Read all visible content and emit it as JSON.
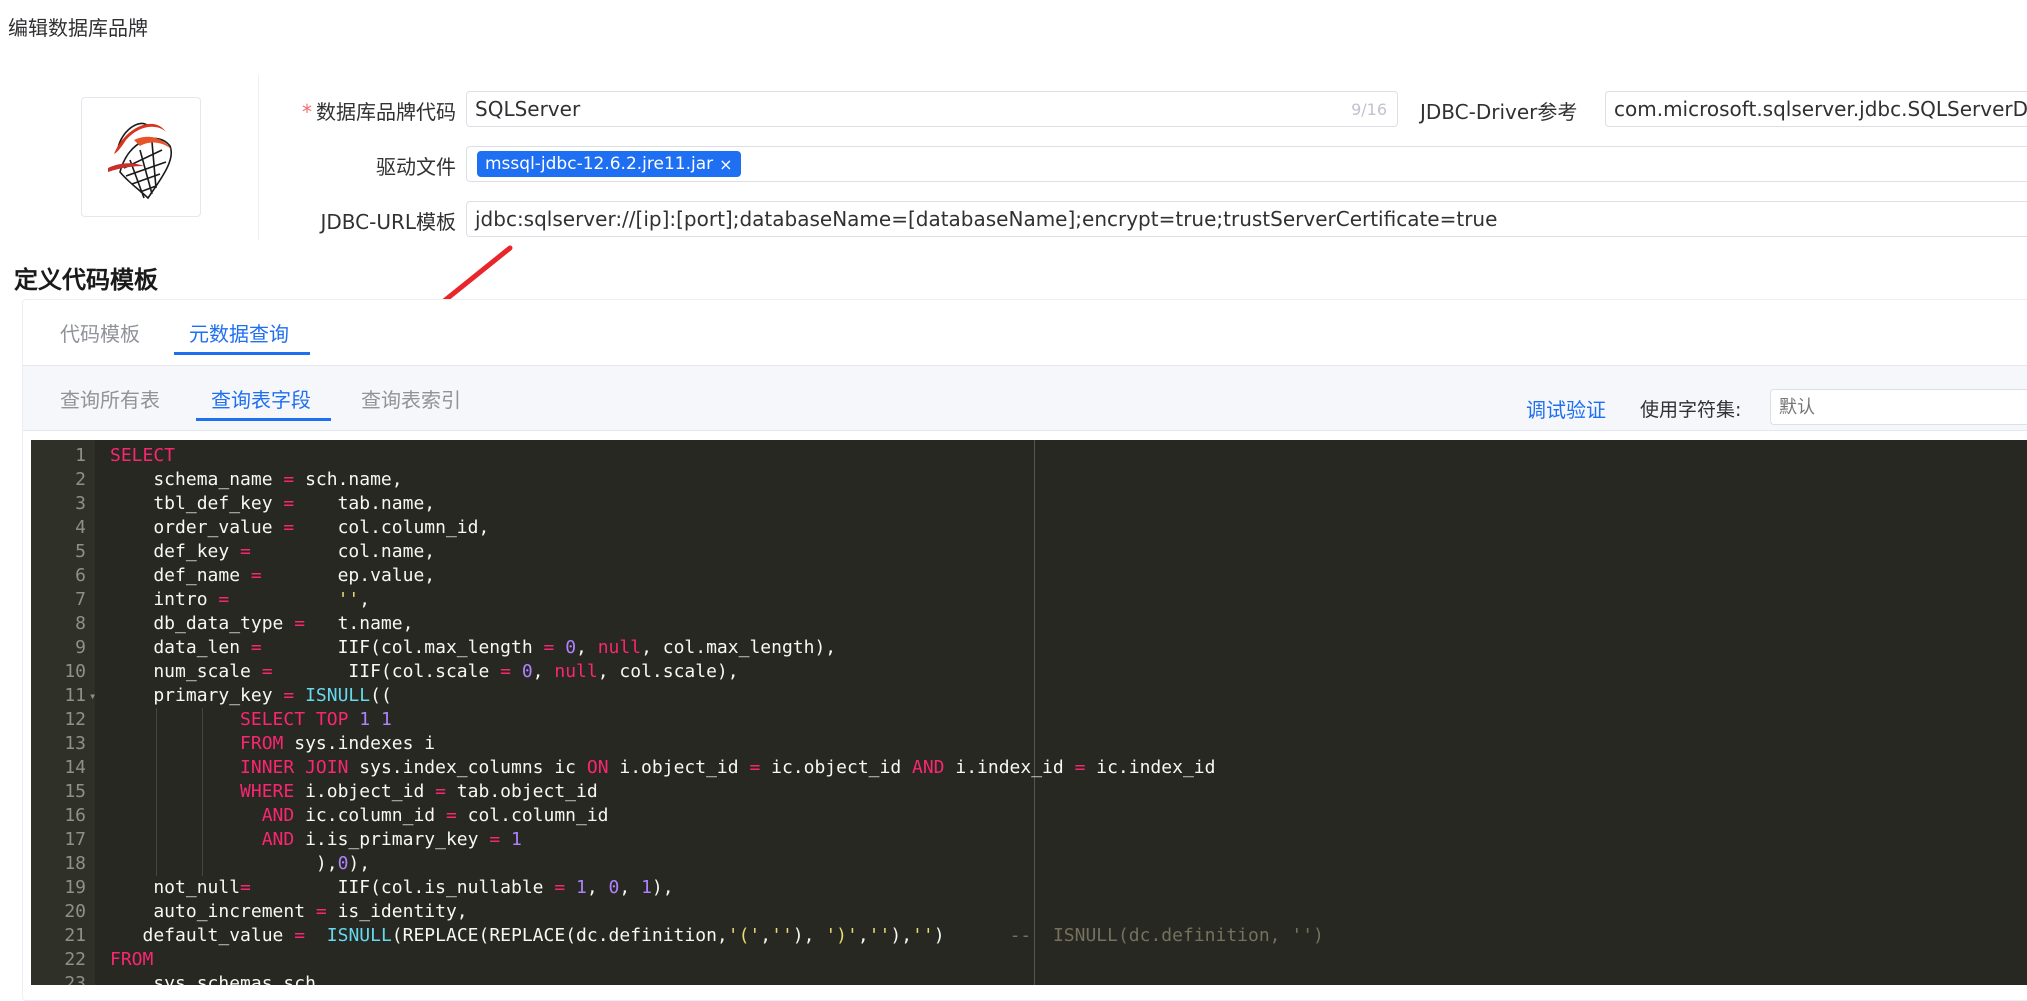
{
  "page": {
    "title": "编辑数据库品牌"
  },
  "form": {
    "brand_code": {
      "label": "数据库品牌代码",
      "required_mark": "*",
      "value": "SQLServer",
      "counter": "9/16"
    },
    "jdbc_driver": {
      "label": "JDBC-Driver参考",
      "value": "com.microsoft.sqlserver.jdbc.SQLServerDriver"
    },
    "driver_file": {
      "label": "驱动文件",
      "tag": "mssql-jdbc-12.6.2.jre11.jar",
      "tag_close": "×"
    },
    "jdbc_url": {
      "label": "JDBC-URL模板",
      "value": "jdbc:sqlserver://[ip]:[port];databaseName=[databaseName];encrypt=true;trustServerCertificate=true"
    }
  },
  "section": {
    "title": "定义代码模板"
  },
  "tabs": [
    {
      "label": "代码模板",
      "active": false
    },
    {
      "label": "元数据查询",
      "active": true
    }
  ],
  "subtabs": [
    {
      "label": "查询所有表",
      "active": false
    },
    {
      "label": "查询表字段",
      "active": true
    },
    {
      "label": "查询表索引",
      "active": false
    }
  ],
  "toolbar": {
    "debug_label": "调试验证",
    "charset_label": "使用字符集:",
    "charset_placeholder": "默认"
  },
  "editor": {
    "theme_colors": {
      "background": "#272822",
      "keyword": "#f92672",
      "function": "#66d9ef",
      "number": "#ae81ff",
      "string": "#e6db74",
      "comment": "#75715e"
    },
    "lines": [
      {
        "n": "1",
        "fold": "",
        "code": [
          [
            "kw",
            "SELECT"
          ]
        ]
      },
      {
        "n": "2",
        "fold": "",
        "code": [
          [
            "t",
            "    schema_name "
          ],
          [
            "kw",
            "="
          ],
          [
            "t",
            " sch.name,"
          ]
        ]
      },
      {
        "n": "3",
        "fold": "",
        "code": [
          [
            "t",
            "    tbl_def_key "
          ],
          [
            "kw",
            "="
          ],
          [
            "t",
            "    tab.name,"
          ]
        ]
      },
      {
        "n": "4",
        "fold": "",
        "code": [
          [
            "t",
            "    order_value "
          ],
          [
            "kw",
            "="
          ],
          [
            "t",
            "    col.column_id,"
          ]
        ]
      },
      {
        "n": "5",
        "fold": "",
        "code": [
          [
            "t",
            "    def_key "
          ],
          [
            "kw",
            "="
          ],
          [
            "t",
            "        col.name,"
          ]
        ]
      },
      {
        "n": "6",
        "fold": "",
        "code": [
          [
            "t",
            "    def_name "
          ],
          [
            "kw",
            "="
          ],
          [
            "t",
            "       ep.value,"
          ]
        ]
      },
      {
        "n": "7",
        "fold": "",
        "code": [
          [
            "t",
            "    intro "
          ],
          [
            "kw",
            "="
          ],
          [
            "t",
            "          "
          ],
          [
            "str",
            "''"
          ],
          [
            "t",
            ","
          ]
        ]
      },
      {
        "n": "8",
        "fold": "",
        "code": [
          [
            "t",
            "    db_data_type "
          ],
          [
            "kw",
            "="
          ],
          [
            "t",
            "   t.name,"
          ]
        ]
      },
      {
        "n": "9",
        "fold": "",
        "code": [
          [
            "t",
            "    data_len "
          ],
          [
            "kw",
            "="
          ],
          [
            "t",
            "       IIF(col.max_length "
          ],
          [
            "kw",
            "="
          ],
          [
            "t",
            " "
          ],
          [
            "num",
            "0"
          ],
          [
            "t",
            ", "
          ],
          [
            "kw",
            "null"
          ],
          [
            "t",
            ", col.max_length),"
          ]
        ]
      },
      {
        "n": "10",
        "fold": "",
        "code": [
          [
            "t",
            "    num_scale "
          ],
          [
            "kw",
            "="
          ],
          [
            "t",
            "       IIF(col.scale "
          ],
          [
            "kw",
            "="
          ],
          [
            "t",
            " "
          ],
          [
            "num",
            "0"
          ],
          [
            "t",
            ", "
          ],
          [
            "kw",
            "null"
          ],
          [
            "t",
            ", col.scale),"
          ]
        ]
      },
      {
        "n": "11",
        "fold": "▾",
        "code": [
          [
            "t",
            "    primary_key "
          ],
          [
            "kw",
            "="
          ],
          [
            "t",
            " "
          ],
          [
            "fn",
            "ISNULL"
          ],
          [
            "t",
            "(("
          ]
        ]
      },
      {
        "n": "12",
        "fold": "",
        "code": [
          [
            "t",
            "            "
          ],
          [
            "kw",
            "SELECT"
          ],
          [
            "t",
            " "
          ],
          [
            "kw",
            "TOP"
          ],
          [
            "t",
            " "
          ],
          [
            "num",
            "1"
          ],
          [
            "t",
            " "
          ],
          [
            "num",
            "1"
          ]
        ]
      },
      {
        "n": "13",
        "fold": "",
        "code": [
          [
            "t",
            "            "
          ],
          [
            "kw",
            "FROM"
          ],
          [
            "t",
            " sys.indexes i"
          ]
        ]
      },
      {
        "n": "14",
        "fold": "",
        "code": [
          [
            "t",
            "            "
          ],
          [
            "kw",
            "INNER"
          ],
          [
            "t",
            " "
          ],
          [
            "kw",
            "JOIN"
          ],
          [
            "t",
            " sys.index_columns ic "
          ],
          [
            "kw",
            "ON"
          ],
          [
            "t",
            " i.object_id "
          ],
          [
            "kw",
            "="
          ],
          [
            "t",
            " ic.object_id "
          ],
          [
            "kw",
            "AND"
          ],
          [
            "t",
            " i.index_id "
          ],
          [
            "kw",
            "="
          ],
          [
            "t",
            " ic.index_id"
          ]
        ]
      },
      {
        "n": "15",
        "fold": "",
        "code": [
          [
            "t",
            "            "
          ],
          [
            "kw",
            "WHERE"
          ],
          [
            "t",
            " i.object_id "
          ],
          [
            "kw",
            "="
          ],
          [
            "t",
            " tab.object_id"
          ]
        ]
      },
      {
        "n": "16",
        "fold": "",
        "code": [
          [
            "t",
            "              "
          ],
          [
            "kw",
            "AND"
          ],
          [
            "t",
            " ic.column_id "
          ],
          [
            "kw",
            "="
          ],
          [
            "t",
            " col.column_id"
          ]
        ]
      },
      {
        "n": "17",
        "fold": "",
        "code": [
          [
            "t",
            "              "
          ],
          [
            "kw",
            "AND"
          ],
          [
            "t",
            " i.is_primary_key "
          ],
          [
            "kw",
            "="
          ],
          [
            "t",
            " "
          ],
          [
            "num",
            "1"
          ]
        ]
      },
      {
        "n": "18",
        "fold": "",
        "code": [
          [
            "t",
            "                   ),"
          ],
          [
            "num",
            "0"
          ],
          [
            "t",
            "),"
          ]
        ]
      },
      {
        "n": "19",
        "fold": "",
        "code": [
          [
            "t",
            "    not_null"
          ],
          [
            "kw",
            "="
          ],
          [
            "t",
            "        IIF(col.is_nullable "
          ],
          [
            "kw",
            "="
          ],
          [
            "t",
            " "
          ],
          [
            "num",
            "1"
          ],
          [
            "t",
            ", "
          ],
          [
            "num",
            "0"
          ],
          [
            "t",
            ", "
          ],
          [
            "num",
            "1"
          ],
          [
            "t",
            "),"
          ]
        ]
      },
      {
        "n": "20",
        "fold": "",
        "code": [
          [
            "t",
            "    auto_increment "
          ],
          [
            "kw",
            "="
          ],
          [
            "t",
            " is_identity,"
          ]
        ]
      },
      {
        "n": "21",
        "fold": "",
        "code": [
          [
            "t",
            "   default_value "
          ],
          [
            "kw",
            "="
          ],
          [
            "t",
            "  "
          ],
          [
            "fn",
            "ISNULL"
          ],
          [
            "t",
            "(REPLACE(REPLACE(dc.definition,"
          ],
          [
            "str",
            "'('"
          ],
          [
            "t",
            ","
          ],
          [
            "str",
            "''"
          ],
          [
            "t",
            "), "
          ],
          [
            "str",
            "')'"
          ],
          [
            "t",
            ","
          ],
          [
            "str",
            "''"
          ],
          [
            "t",
            "),"
          ],
          [
            "str",
            "''"
          ],
          [
            "t",
            ")      "
          ],
          [
            "cm",
            "--  ISNULL(dc.definition, '')"
          ]
        ]
      },
      {
        "n": "22",
        "fold": "",
        "code": [
          [
            "kw",
            "FROM"
          ]
        ]
      },
      {
        "n": "23",
        "fold": "",
        "code": [
          [
            "t",
            "    sys.schemas sch"
          ]
        ]
      }
    ]
  }
}
